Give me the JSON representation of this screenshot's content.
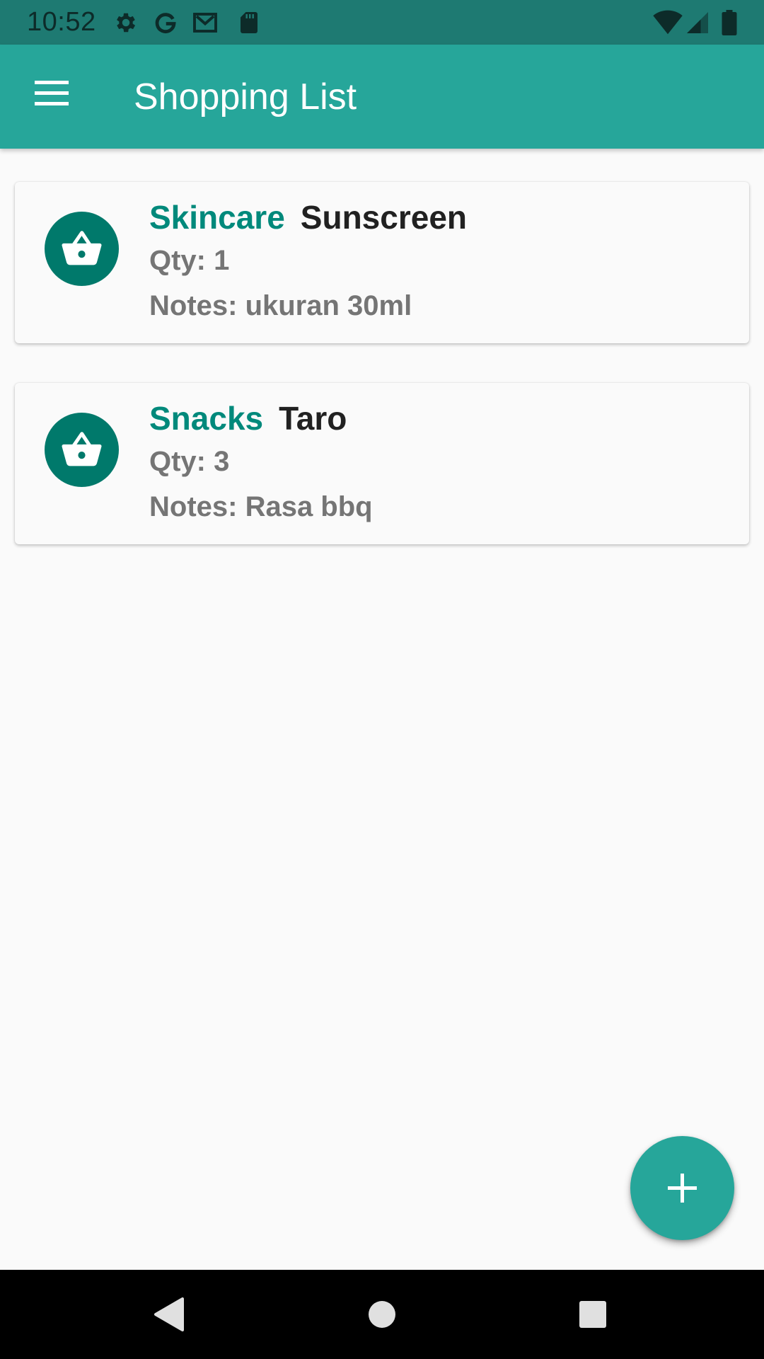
{
  "status_bar": {
    "time": "10:52",
    "icons_left": [
      "gear-icon",
      "google-icon",
      "gmail-icon",
      "sd-card-icon"
    ],
    "icons_right": [
      "wifi-icon",
      "cell-signal-icon",
      "battery-icon"
    ]
  },
  "app_bar": {
    "title": "Shopping List",
    "menu_icon": "menu-icon"
  },
  "items": [
    {
      "category": "Skincare",
      "name": "Sunscreen",
      "qty": "Qty: 1",
      "notes": "Notes: ukuran 30ml",
      "icon": "basket-icon"
    },
    {
      "category": "Snacks",
      "name": "Taro",
      "qty": "Qty: 3",
      "notes": "Notes: Rasa bbq",
      "icon": "basket-icon"
    }
  ],
  "fab": {
    "icon": "plus-icon"
  },
  "nav_bar": {
    "buttons": [
      "back-icon",
      "home-icon",
      "recents-icon"
    ]
  },
  "colors": {
    "status_bar": "#1e7a72",
    "primary": "#26a69a",
    "primary_dark": "#00796b",
    "category_text": "#00897b",
    "background": "#fafafa"
  }
}
